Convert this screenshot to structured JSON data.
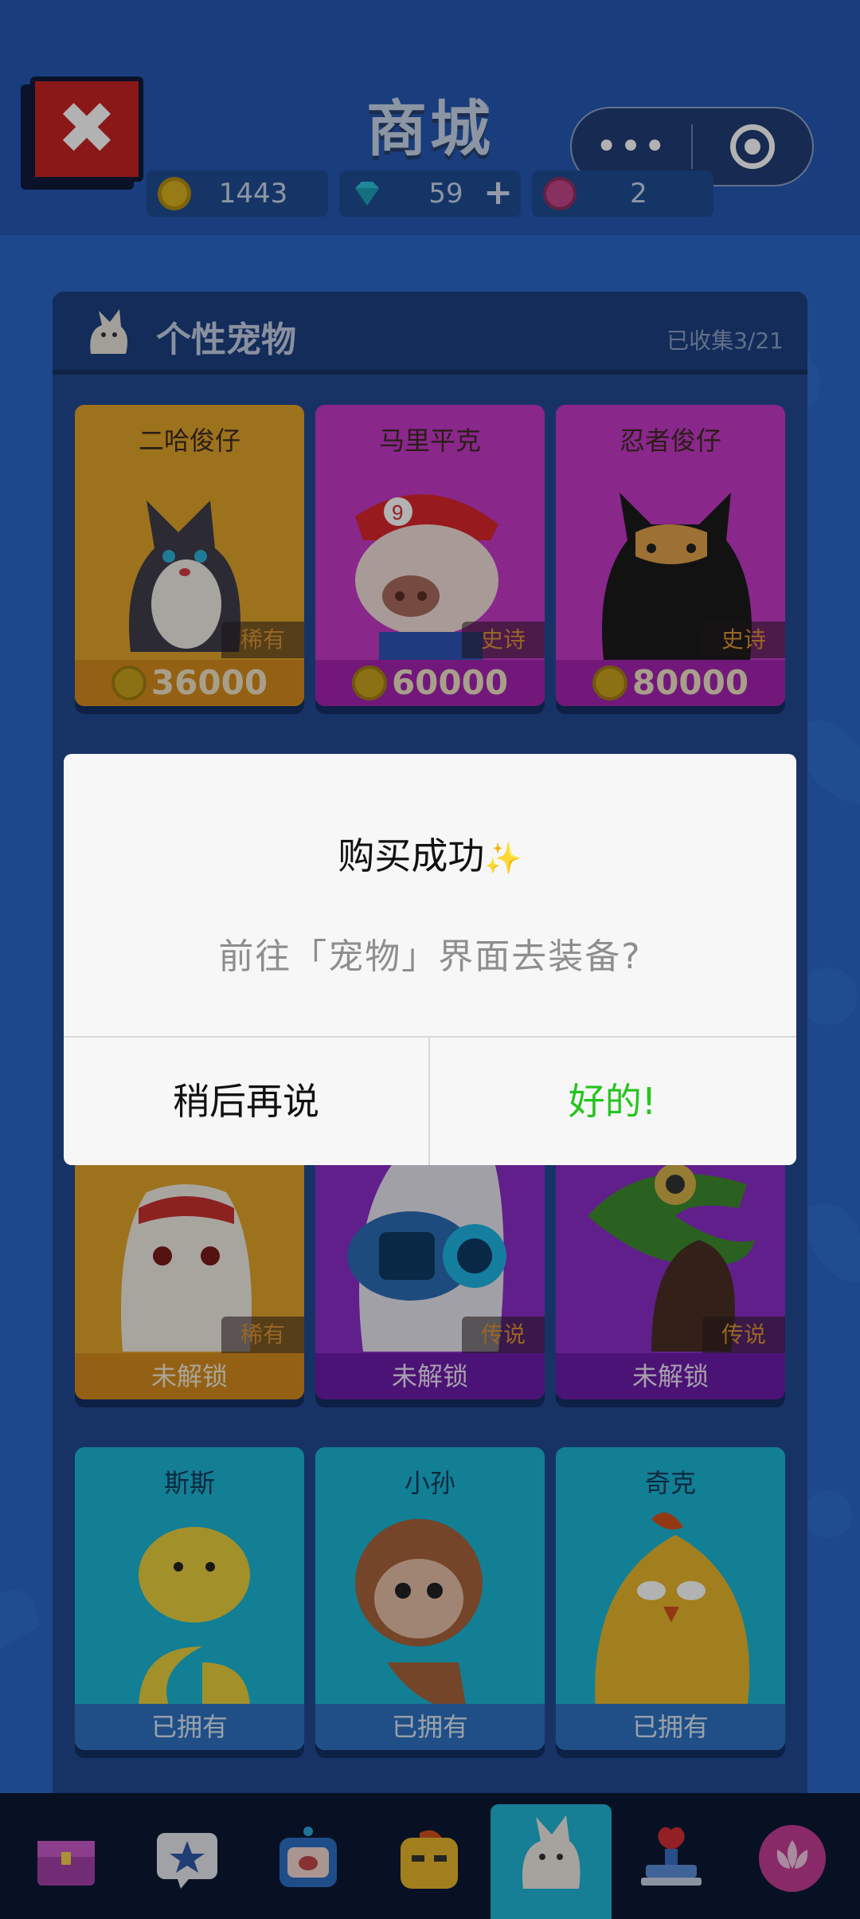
{
  "header": {
    "title": "商城",
    "currencies": [
      {
        "icon": "gold-coin-icon",
        "value": "1443"
      },
      {
        "icon": "diamond-icon",
        "value": "59",
        "has_add": true
      },
      {
        "icon": "flower-token-icon",
        "value": "2"
      }
    ]
  },
  "panel": {
    "title": "个性宠物",
    "collected": "已收集3/21"
  },
  "cards_row1": [
    {
      "name": "二哈俊仔",
      "tag": "稀有",
      "price": "36000",
      "color": "#e1a42a"
    },
    {
      "name": "马里平克",
      "tag": "史诗",
      "price": "60000",
      "color": "#c438c8"
    },
    {
      "name": "忍者俊仔",
      "tag": "史诗",
      "price": "80000",
      "color": "#c438c8"
    }
  ],
  "cards_row3": [
    {
      "tag": "稀有",
      "status": "未解锁",
      "color": "#e1a42a"
    },
    {
      "tag": "传说",
      "status": "未解锁",
      "color": "#8b2dc7"
    },
    {
      "tag": "传说",
      "status": "未解锁",
      "color": "#8b2dc7"
    }
  ],
  "cards_row4": [
    {
      "name": "斯斯",
      "status": "已拥有",
      "color": "#1bb6d6"
    },
    {
      "name": "小孙",
      "status": "已拥有",
      "color": "#1bb6d6"
    },
    {
      "name": "奇克",
      "status": "已拥有",
      "color": "#1bb6d6"
    }
  ],
  "dialog": {
    "title": "购买成功",
    "sparkle": "✨",
    "message": "前往「宠物」界面去装备?",
    "cancel": "稍后再说",
    "ok": "好的!"
  },
  "navbar": {
    "items": [
      "chest-icon",
      "star-chat-icon",
      "tv-icon",
      "character-icon",
      "pet-icon",
      "stamp-icon",
      "flower-icon"
    ],
    "active": 4
  }
}
